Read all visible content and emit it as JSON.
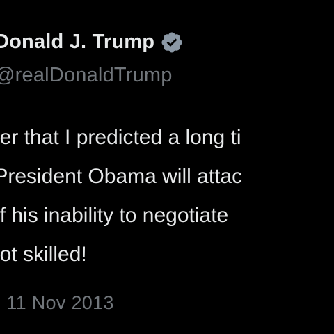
{
  "author": {
    "display_name": "Donald J. Trump",
    "handle": "@realDonaldTrump",
    "verified_icon": "verified-badge-icon",
    "verified_color": "#8b98a5"
  },
  "tweet": {
    "lines": [
      "mber that I predicted a long ti",
      "at President Obama will attac",
      "e of his inability to negotiate",
      "y-not skilled!"
    ]
  },
  "meta": {
    "separator": "·",
    "date": "11 Nov 2013"
  },
  "colors": {
    "background": "#000000",
    "text": "#e7e9ea",
    "secondary": "#71767b"
  }
}
